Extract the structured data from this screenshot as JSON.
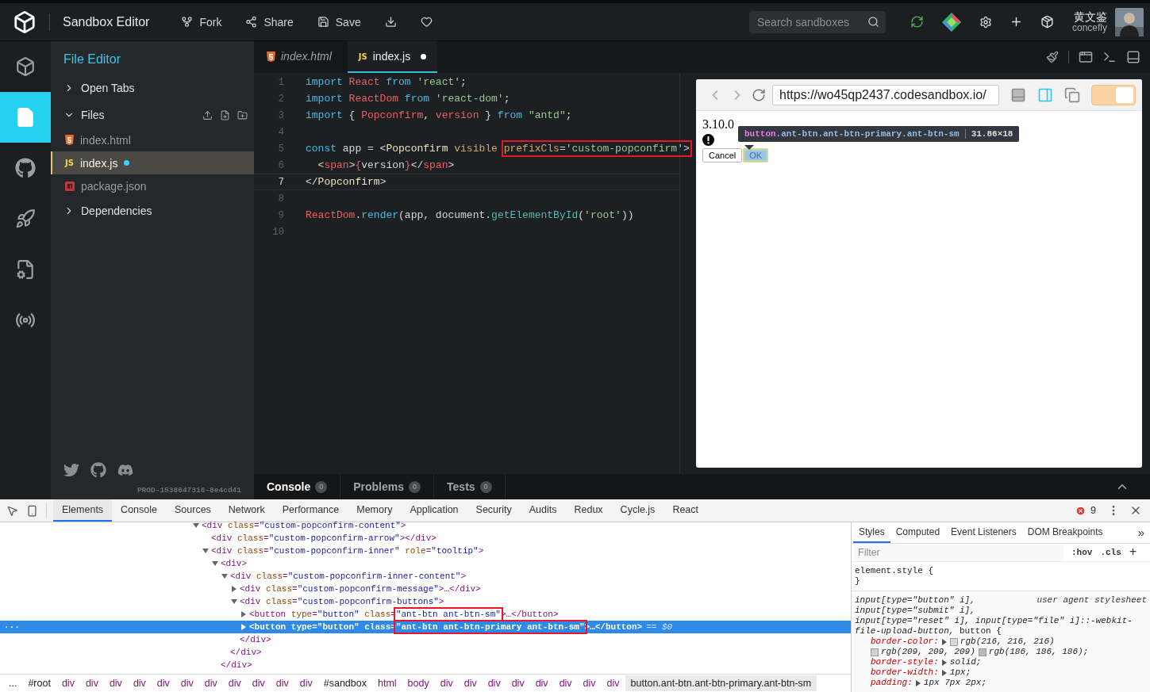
{
  "header": {
    "title": "Sandbox Editor",
    "actions": [
      {
        "kind": "fork",
        "label": "Fork"
      },
      {
        "kind": "share",
        "label": "Share"
      },
      {
        "kind": "save",
        "label": "Save"
      },
      {
        "kind": "download"
      },
      {
        "kind": "like"
      }
    ],
    "search": {
      "placeholder": "Search sandboxes"
    },
    "user": {
      "name": "黄文鉴",
      "handle": "concefly"
    }
  },
  "rail": [
    {
      "kind": "project",
      "selected": false
    },
    {
      "kind": "files",
      "selected": true
    },
    {
      "kind": "github",
      "selected": false
    },
    {
      "kind": "deploy",
      "selected": false
    },
    {
      "kind": "config",
      "selected": false
    },
    {
      "kind": "live",
      "selected": false
    }
  ],
  "sidebar": {
    "title": "File Editor",
    "sections": [
      {
        "label": "Open Tabs",
        "expanded": false
      },
      {
        "label": "Files",
        "expanded": true,
        "files": [
          {
            "kind": "html",
            "name": "index.html",
            "selected": false,
            "modified": false
          },
          {
            "kind": "js",
            "badge": "JS",
            "name": "index.js",
            "selected": true,
            "modified": true
          },
          {
            "kind": "npm",
            "name": "package.json",
            "selected": false,
            "modified": false
          }
        ]
      },
      {
        "label": "Dependencies",
        "expanded": false
      }
    ],
    "version": "PROD-1538647316-8e4cd41"
  },
  "editor": {
    "tabs": [
      {
        "kind": "html",
        "label": "index.html",
        "selected": false,
        "modified": false
      },
      {
        "kind": "js",
        "badge": "JS",
        "label": "index.js",
        "selected": true,
        "modified": true
      }
    ],
    "lines": [
      {
        "number": "1",
        "active": false,
        "tokens": [
          {
            "kind": "kw",
            "text": "import "
          },
          {
            "kind": "var",
            "text": "React "
          },
          {
            "kind": "kw",
            "text": "from "
          },
          {
            "kind": "str",
            "text": "'react'"
          },
          {
            "kind": "plain",
            "text": ";"
          }
        ]
      },
      {
        "number": "2",
        "active": false,
        "tokens": [
          {
            "kind": "kw",
            "text": "import "
          },
          {
            "kind": "var",
            "text": "ReactDom "
          },
          {
            "kind": "kw",
            "text": "from "
          },
          {
            "kind": "str",
            "text": "'react-dom'"
          },
          {
            "kind": "plain",
            "text": ";"
          }
        ]
      },
      {
        "number": "3",
        "active": false,
        "tokens": [
          {
            "kind": "kw",
            "text": "import "
          },
          {
            "kind": "plain",
            "text": "{ "
          },
          {
            "kind": "var",
            "text": "Popconfirm"
          },
          {
            "kind": "plain",
            "text": ", "
          },
          {
            "kind": "var",
            "text": "version"
          },
          {
            "kind": "plain",
            "text": " } "
          },
          {
            "kind": "kw",
            "text": "from "
          },
          {
            "kind": "str",
            "text": "\"antd\""
          },
          {
            "kind": "plain",
            "text": ";"
          }
        ]
      },
      {
        "number": "4",
        "active": false
      },
      {
        "number": "5",
        "active": false,
        "tokens": [
          {
            "kind": "kw",
            "text": "const "
          },
          {
            "kind": "plain",
            "text": "app = <"
          },
          {
            "kind": "tag",
            "text": "Popconfirm "
          },
          {
            "kind": "attr",
            "text": "visible "
          }
        ],
        "outlined_tokens": [
          {
            "kind": "attr",
            "text": "prefixCls"
          },
          {
            "kind": "plain",
            "text": "="
          },
          {
            "kind": "str",
            "text": "'custom-popconfirm'"
          },
          {
            "kind": "plain",
            "text": ">"
          }
        ]
      },
      {
        "number": "6",
        "active": false,
        "tokens": [
          {
            "kind": "plain",
            "text": "  <"
          },
          {
            "kind": "var",
            "text": "span"
          },
          {
            "kind": "plain",
            "text": ">"
          },
          {
            "kind": "var",
            "text": "{"
          },
          {
            "kind": "plain",
            "text": "version"
          },
          {
            "kind": "var",
            "text": "}"
          },
          {
            "kind": "plain",
            "text": "</"
          },
          {
            "kind": "var",
            "text": "span"
          },
          {
            "kind": "plain",
            "text": ">"
          }
        ]
      },
      {
        "number": "7",
        "active": true,
        "tokens": [
          {
            "kind": "plain",
            "text": "</"
          },
          {
            "kind": "tag",
            "text": "Popconfirm"
          },
          {
            "kind": "plain",
            "text": ">"
          }
        ]
      },
      {
        "number": "8",
        "active": false
      },
      {
        "number": "9",
        "active": false,
        "tokens": [
          {
            "kind": "var",
            "text": "ReactDom"
          },
          {
            "kind": "plain",
            "text": "."
          },
          {
            "kind": "fn",
            "text": "render"
          },
          {
            "kind": "plain",
            "text": "(app, document."
          },
          {
            "kind": "method",
            "text": "getElementById"
          },
          {
            "kind": "plain",
            "text": "("
          },
          {
            "kind": "str",
            "text": "'root'"
          },
          {
            "kind": "plain",
            "text": "))"
          }
        ]
      },
      {
        "number": "10",
        "active": false
      }
    ]
  },
  "preview": {
    "url": "https://wo45qp2437.codesandbox.io/",
    "view_modes": [
      {
        "kind": "bottom",
        "selected": false
      },
      {
        "kind": "side",
        "selected": true
      },
      {
        "kind": "window",
        "selected": false
      }
    ],
    "toggle": {
      "on": true
    },
    "version_text": "3.10.0",
    "buttons": [
      {
        "label": "Cancel",
        "highlighted": false
      },
      {
        "label": "OK",
        "highlighted": true
      }
    ],
    "tooltip": {
      "tag": "button",
      "classes": ".ant-btn.ant-btn-primary.ant-btn-sm",
      "size": "31.86×18"
    }
  },
  "console_bar": {
    "tabs": [
      {
        "label": "Console",
        "count": "0",
        "selected": true
      },
      {
        "label": "Problems",
        "count": "0",
        "selected": false
      },
      {
        "label": "Tests",
        "count": "0",
        "selected": false
      }
    ]
  },
  "devtools": {
    "tabs": [
      {
        "label": "Elements",
        "selected": true
      },
      {
        "label": "Console",
        "selected": false
      },
      {
        "label": "Sources",
        "selected": false
      },
      {
        "label": "Network",
        "selected": false
      },
      {
        "label": "Performance",
        "selected": false
      },
      {
        "label": "Memory",
        "selected": false
      },
      {
        "label": "Application",
        "selected": false
      },
      {
        "label": "Security",
        "selected": false
      },
      {
        "label": "Audits",
        "selected": false
      },
      {
        "label": "Redux",
        "selected": false
      },
      {
        "label": "Cycle.js",
        "selected": false
      },
      {
        "label": "React",
        "selected": false
      }
    ],
    "error_count": "9",
    "dom_tree": [
      {
        "text": "<div class=\"custom-popconfirm-content\">",
        "expanded": true,
        "selected": false,
        "children": [
          {
            "text": "<div class=\"custom-popconfirm-arrow\"></div>",
            "selected": false
          },
          {
            "text": "<div class=\"custom-popconfirm-inner\" role=\"tooltip\">",
            "expanded": true,
            "selected": false,
            "children": [
              {
                "text": "<div>",
                "expanded": true,
                "selected": false,
                "close": "</div>",
                "children": [
                  {
                    "text": "<div class=\"custom-popconfirm-inner-content\">",
                    "expanded": true,
                    "selected": false,
                    "close": "</div>",
                    "children": [
                      {
                        "text": "<div class=\"custom-popconfirm-message\">…</div>",
                        "expanded": false,
                        "selected": false
                      },
                      {
                        "text": "<div class=\"custom-popconfirm-buttons\">",
                        "expanded": true,
                        "selected": false,
                        "close": "</div>",
                        "children": [
                          {
                            "text": "<button type=\"button\" class=\"ant-btn ant-btn-sm\">…</button>",
                            "expanded": false,
                            "selected": false,
                            "outlined": true
                          },
                          {
                            "text": "<button type=\"button\" class=\"ant-btn ant-btn-primary ant-btn-sm\">…</button>",
                            "expanded": false,
                            "selected": true,
                            "outlined": true,
                            "menu": "...",
                            "suffix": "== $0"
                          }
                        ]
                      }
                    ]
                  }
                ]
              }
            ]
          }
        ]
      }
    ],
    "breadcrumbs": [
      {
        "kind": "more",
        "label": "...",
        "selected": false
      },
      {
        "kind": "id",
        "label": "#root",
        "selected": false
      },
      {
        "kind": "tag",
        "label": "div",
        "selected": false
      },
      {
        "kind": "tag",
        "label": "div",
        "selected": false
      },
      {
        "kind": "tag",
        "label": "div",
        "selected": false
      },
      {
        "kind": "tag",
        "label": "div",
        "selected": false
      },
      {
        "kind": "tag",
        "label": "div",
        "selected": false
      },
      {
        "kind": "tag",
        "label": "div",
        "selected": false
      },
      {
        "kind": "tag",
        "label": "div",
        "selected": false
      },
      {
        "kind": "tag",
        "label": "div",
        "selected": false
      },
      {
        "kind": "tag",
        "label": "div",
        "selected": false
      },
      {
        "kind": "tag",
        "label": "div",
        "selected": false
      },
      {
        "kind": "tag",
        "label": "div",
        "selected": false
      },
      {
        "kind": "id",
        "label": "#sandbox",
        "selected": false
      },
      {
        "kind": "tag",
        "label": "html",
        "selected": false
      },
      {
        "kind": "tag",
        "label": "body",
        "selected": false
      },
      {
        "kind": "tag",
        "label": "div",
        "selected": false
      },
      {
        "kind": "tag",
        "label": "div",
        "selected": false
      },
      {
        "kind": "tag",
        "label": "div",
        "selected": false
      },
      {
        "kind": "tag",
        "label": "div",
        "selected": false
      },
      {
        "kind": "tag",
        "label": "div",
        "selected": false
      },
      {
        "kind": "tag",
        "label": "div",
        "selected": false
      },
      {
        "kind": "tag",
        "label": "div",
        "selected": false
      },
      {
        "kind": "tag",
        "label": "div",
        "selected": false
      },
      {
        "kind": "selector",
        "label": "button.ant-btn.ant-btn-primary.ant-btn-sm",
        "selected": true
      }
    ],
    "styles": {
      "tabs": [
        {
          "label": "Styles",
          "selected": true
        },
        {
          "label": "Computed",
          "selected": false
        },
        {
          "label": "Event Listeners",
          "selected": false
        },
        {
          "label": "DOM Breakpoints",
          "selected": false
        }
      ],
      "more": "»",
      "filter": {
        "placeholder": "Filter"
      },
      "toggles": [
        ":hov",
        ".cls",
        "+"
      ],
      "element_rule": {
        "selector": "element.style {",
        "close": "}"
      },
      "rule": {
        "selector_lines": [
          "*input[type=\"button\" i],*",
          "*input[type=\"submit\" i],*",
          "*input[type=\"reset\" i], input[type=\"file\" i]::-webkit-file-upload-button,* button {"
        ],
        "source": "user agent stylesheet",
        "props": [
          {
            "name": "border-color:",
            "values": [
              {
                "color": "#d8d8d8",
                "text": "rgb(216, 216, 216)"
              },
              {
                "color": "#d1d1d1",
                "text": "rgb(209, 209, 209)"
              },
              {
                "color": "#bababa",
                "text": "rgb(186, 186, 186);"
              }
            ]
          },
          {
            "name": "border-style:",
            "value": "solid;"
          },
          {
            "name": "border-width:",
            "value": "1px;"
          },
          {
            "name": "padding:",
            "value": "1px 7px 2px;"
          }
        ]
      }
    }
  }
}
